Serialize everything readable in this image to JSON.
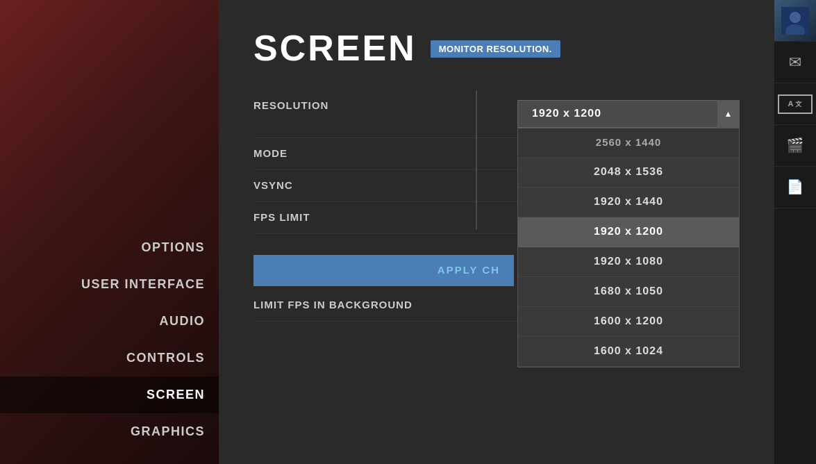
{
  "sidebar": {
    "items": [
      {
        "id": "options",
        "label": "OPTIONS",
        "active": false
      },
      {
        "id": "user-interface",
        "label": "USER INTERFACE",
        "active": false
      },
      {
        "id": "audio",
        "label": "AUDIO",
        "active": false
      },
      {
        "id": "controls",
        "label": "CONTROLS",
        "active": false
      },
      {
        "id": "screen",
        "label": "SCREEN",
        "active": true
      },
      {
        "id": "graphics",
        "label": "GRAPHICS",
        "active": false
      }
    ]
  },
  "main": {
    "title": "SCREEN",
    "tooltip": "Monitor resolution.",
    "settings": [
      {
        "id": "resolution",
        "label": "RESOLUTION"
      },
      {
        "id": "mode",
        "label": "MODE"
      },
      {
        "id": "vsync",
        "label": "VSYNC"
      },
      {
        "id": "fps-limit",
        "label": "FPS LIMIT"
      }
    ],
    "apply_button": "APPLY CH",
    "extra_setting": "LIMIT FPS IN BACKGROUND",
    "resolution": {
      "selected": "1920 x 1200",
      "options": [
        {
          "value": "2560 x 1440",
          "partial": true
        },
        {
          "value": "2048 x 1536"
        },
        {
          "value": "1920 x 1440"
        },
        {
          "value": "1920 x 1200",
          "selected": true
        },
        {
          "value": "1920 x 1080"
        },
        {
          "value": "1680 x 1050"
        },
        {
          "value": "1600 x 1200"
        },
        {
          "value": "1600 x 1024"
        }
      ]
    }
  },
  "right_sidebar": {
    "icons": [
      {
        "id": "avatar",
        "label": "👤"
      },
      {
        "id": "mail",
        "label": "✉"
      },
      {
        "id": "translate",
        "label_a": "A",
        "label_b": "文"
      },
      {
        "id": "camera",
        "label": "🎬"
      },
      {
        "id": "document",
        "label": "📄"
      }
    ]
  }
}
